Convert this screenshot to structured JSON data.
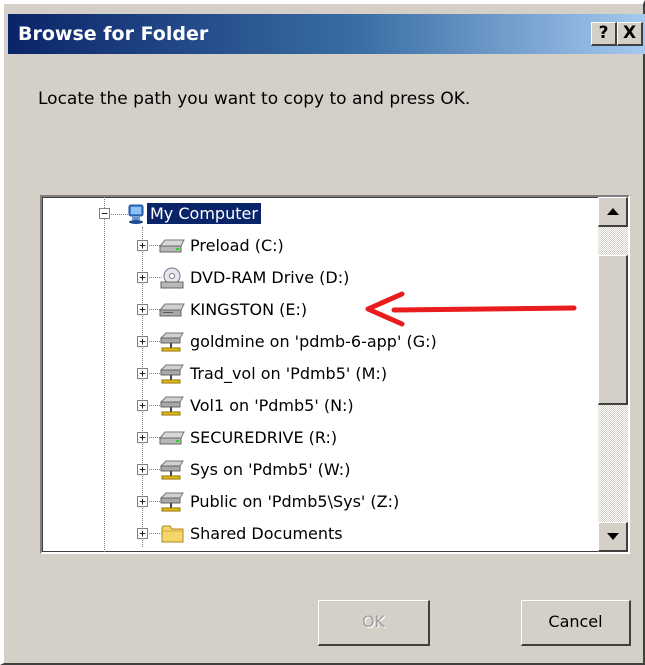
{
  "window": {
    "title": "Browse for Folder",
    "help_label": "?",
    "close_label": "X"
  },
  "instruction": "Locate the path you want to copy to and press OK.",
  "tree": {
    "root": {
      "label": "My Computer",
      "icon": "computer-icon",
      "expander": "−",
      "selected": true
    },
    "items": [
      {
        "label": "Preload (C:)",
        "icon": "hard-drive-icon",
        "expander": "+"
      },
      {
        "label": "DVD-RAM Drive (D:)",
        "icon": "dvd-drive-icon",
        "expander": "+"
      },
      {
        "label": "KINGSTON (E:)",
        "icon": "removable-drive-icon",
        "expander": "+"
      },
      {
        "label": "goldmine on 'pdmb-6-app' (G:)",
        "icon": "network-drive-icon",
        "expander": "+"
      },
      {
        "label": "Trad_vol on 'Pdmb5' (M:)",
        "icon": "network-drive-icon",
        "expander": "+"
      },
      {
        "label": "Vol1 on 'Pdmb5' (N:)",
        "icon": "network-drive-icon",
        "expander": "+"
      },
      {
        "label": "SECUREDRIVE (R:)",
        "icon": "hard-drive-icon",
        "expander": "+"
      },
      {
        "label": "Sys on 'Pdmb5' (W:)",
        "icon": "network-drive-icon",
        "expander": "+"
      },
      {
        "label": "Public on 'Pdmb5\\Sys' (Z:)",
        "icon": "network-drive-icon",
        "expander": "+"
      },
      {
        "label": "Shared Documents",
        "icon": "folder-icon",
        "expander": "+"
      }
    ]
  },
  "buttons": {
    "ok_label": "OK",
    "ok_enabled": false,
    "cancel_label": "Cancel"
  },
  "annotation": {
    "color": "#e81c1c",
    "target": "KINGSTON (E:)"
  },
  "colors": {
    "title_bar_start": "#0a246a",
    "selection": "#0a246a",
    "dialog_face": "#d4d0c8"
  }
}
